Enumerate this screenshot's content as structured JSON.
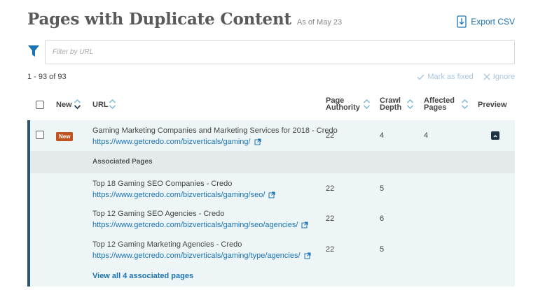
{
  "header": {
    "title": "Pages with Duplicate Content",
    "as_of": "As of May 23",
    "export_label": "Export CSV"
  },
  "filter": {
    "placeholder": "Filter by URL",
    "value": ""
  },
  "results": {
    "count_label": "1 - 93 of 93",
    "mark_fixed_label": "Mark as fixed",
    "ignore_label": "Ignore"
  },
  "columns": {
    "new": "New",
    "url": "URL",
    "page_authority_line1": "Page",
    "page_authority_line2": "Authority",
    "crawl_depth_line1": "Crawl",
    "crawl_depth_line2": "Depth",
    "affected_pages_line1": "Affected",
    "affected_pages_line2": "Pages",
    "preview": "Preview"
  },
  "main_row": {
    "badge": "New",
    "title": "Gaming Marketing Companies and Marketing Services for 2018 - Credo",
    "url": "https://www.getcredo.com/bizverticals/gaming/",
    "page_authority": "22",
    "crawl_depth": "4",
    "affected_pages": "4"
  },
  "associated": {
    "header": "Associated Pages",
    "rows": [
      {
        "title": "Top 18 Gaming SEO Companies - Credo",
        "url": "https://www.getcredo.com/bizverticals/gaming/seo/",
        "page_authority": "22",
        "crawl_depth": "5"
      },
      {
        "title": "Top 12 Gaming SEO Agencies - Credo",
        "url": "https://www.getcredo.com/bizverticals/gaming/seo/agencies/",
        "page_authority": "22",
        "crawl_depth": "6"
      },
      {
        "title": "Top 12 Gaming Marketing Agencies - Credo",
        "url": "https://www.getcredo.com/bizverticals/gaming/type/agencies/",
        "page_authority": "22",
        "crawl_depth": "5"
      }
    ],
    "view_all_label": "View all 4 associated pages"
  },
  "colors": {
    "accent": "#1a73b5",
    "badge": "#c0531f",
    "row_border": "#2a5470",
    "row_bg": "#eef5f6",
    "title": "#5a5a5a"
  },
  "icons": {
    "export": "download-file-icon",
    "filter": "funnel-icon",
    "mark_fixed": "check-icon",
    "ignore": "x-icon",
    "sort": "sort-arrows-icon",
    "external_link": "external-link-icon",
    "preview": "collapse-icon"
  }
}
